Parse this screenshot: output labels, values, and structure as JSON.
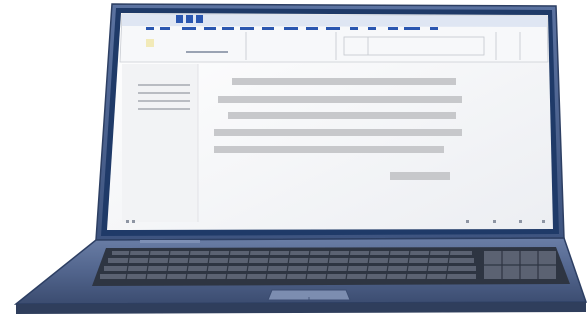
{
  "scene": {
    "subject": "laptop-displaying-word-processor",
    "colors": {
      "body": "#4a5f86",
      "body_dark": "#33466a",
      "bezel": "#1f3a68",
      "screen_bg": "#f4f5f7",
      "ribbon_blue": "#2a56b0",
      "text_line": "#c7c8cb",
      "keys": "#3a3f48"
    },
    "icons": [
      "app-logo-icon",
      "window-control-icon"
    ],
    "document": {
      "line_count": 5,
      "has_sidebar": true,
      "has_ribbon": true
    }
  }
}
